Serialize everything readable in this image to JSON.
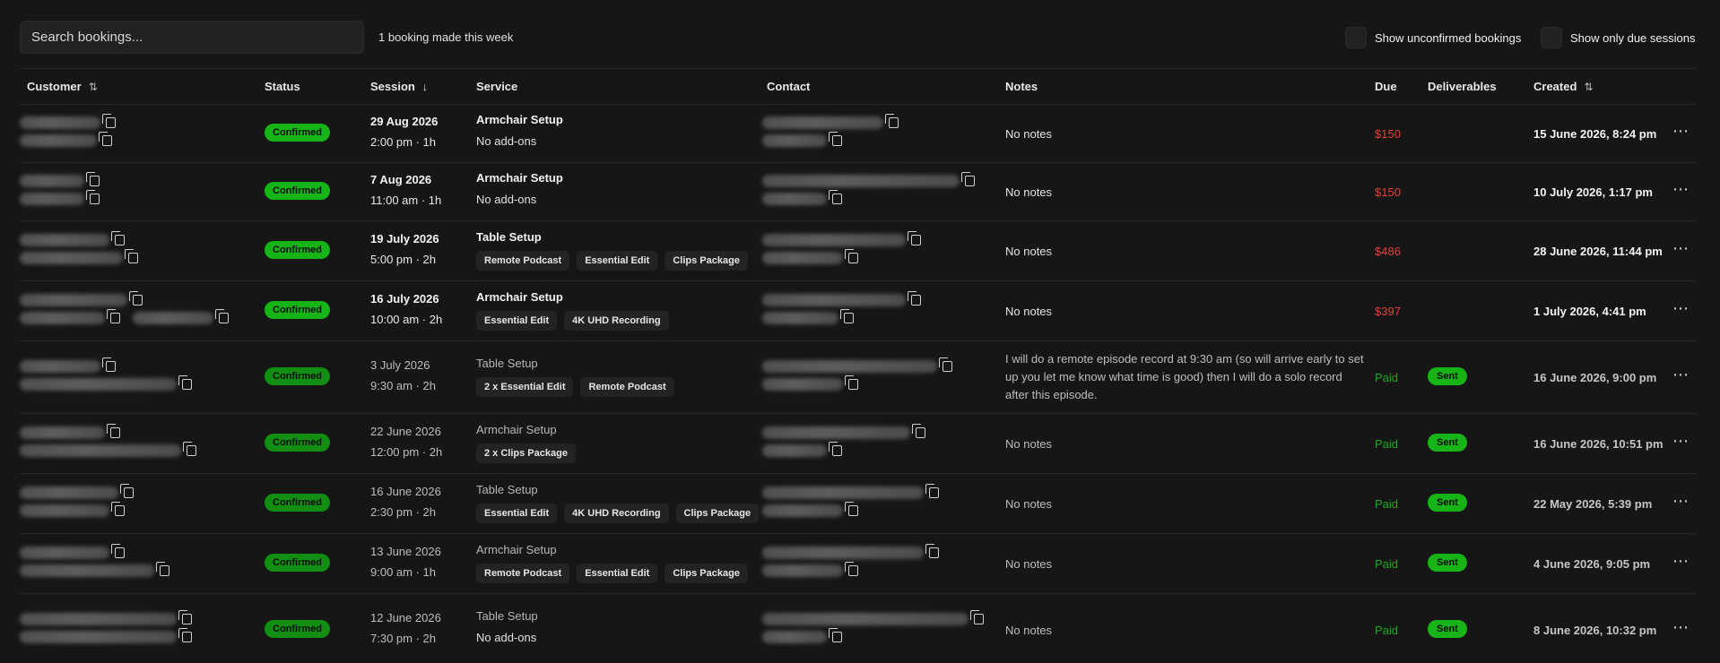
{
  "search": {
    "placeholder": "Search bookings..."
  },
  "summary": "1 booking made this week",
  "filters": {
    "unconfirmed": "Show unconfirmed bookings",
    "due_only": "Show only due sessions"
  },
  "columns": {
    "customer": "Customer",
    "status": "Status",
    "session": "Session",
    "service": "Service",
    "contact": "Contact",
    "notes": "Notes",
    "due": "Due",
    "deliverables": "Deliverables",
    "created": "Created"
  },
  "rows": [
    {
      "status": "Confirmed",
      "date": "29 Aug 2026",
      "time": "2:00 pm · 1h",
      "service": "Armchair Setup",
      "addons": "No add-ons",
      "notes": "No notes",
      "due": "$150",
      "created": "15 June 2026, 8:24 pm"
    },
    {
      "status": "Confirmed",
      "date": "7 Aug 2026",
      "time": "11:00 am · 1h",
      "service": "Armchair Setup",
      "addons": "No add-ons",
      "notes": "No notes",
      "due": "$150",
      "created": "10 July 2026, 1:17 pm"
    },
    {
      "status": "Confirmed",
      "date": "19 July 2026",
      "time": "5:00 pm · 2h",
      "service": "Table Setup",
      "tags": [
        "Remote Podcast",
        "Essential Edit",
        "Clips Package"
      ],
      "notes": "No notes",
      "due": "$486",
      "created": "28 June 2026, 11:44 pm"
    },
    {
      "status": "Confirmed",
      "date": "16 July 2026",
      "time": "10:00 am · 2h",
      "service": "Armchair Setup",
      "tags": [
        "Essential Edit",
        "4K UHD Recording"
      ],
      "notes": "No notes",
      "due": "$397",
      "created": "1 July 2026, 4:41 pm"
    },
    {
      "status": "Confirmed",
      "date": "3 July 2026",
      "time": "9:30 am · 2h",
      "service": "Table Setup",
      "tags": [
        "2 x Essential Edit",
        "Remote Podcast"
      ],
      "notes": "I will do a remote episode record at 9:30 am (so will arrive early to set up you let me know what time is good) then I will do a solo record after this episode.",
      "due": "Paid",
      "deliverable": "Sent",
      "created": "16 June 2026, 9:00 pm"
    },
    {
      "status": "Confirmed",
      "date": "22 June 2026",
      "time": "12:00 pm · 2h",
      "service": "Armchair Setup",
      "tags": [
        "2 x Clips Package"
      ],
      "notes": "No notes",
      "due": "Paid",
      "deliverable": "Sent",
      "created": "16 June 2026, 10:51 pm"
    },
    {
      "status": "Confirmed",
      "date": "16 June 2026",
      "time": "2:30 pm · 2h",
      "service": "Table Setup",
      "tags": [
        "Essential Edit",
        "4K UHD Recording",
        "Clips Package"
      ],
      "notes": "No notes",
      "due": "Paid",
      "deliverable": "Sent",
      "created": "22 May 2026, 5:39 pm"
    },
    {
      "status": "Confirmed",
      "date": "13 June 2026",
      "time": "9:00 am · 1h",
      "service": "Armchair Setup",
      "tags": [
        "Remote Podcast",
        "Essential Edit",
        "Clips Package"
      ],
      "notes": "No notes",
      "due": "Paid",
      "deliverable": "Sent",
      "created": "4 June 2026, 9:05 pm"
    },
    {
      "status": "Confirmed",
      "date": "12 June 2026",
      "time": "7:30 pm · 2h",
      "service": "Table Setup",
      "addons": "No add-ons",
      "notes": "No notes",
      "due": "Paid",
      "deliverable": "Sent",
      "created": "8 June 2026, 10:32 pm"
    }
  ],
  "more_icon": "⋯",
  "colors": {
    "confirmed": "#17b417",
    "unpaid": "#e0423c",
    "paid": "#1ca91c"
  }
}
